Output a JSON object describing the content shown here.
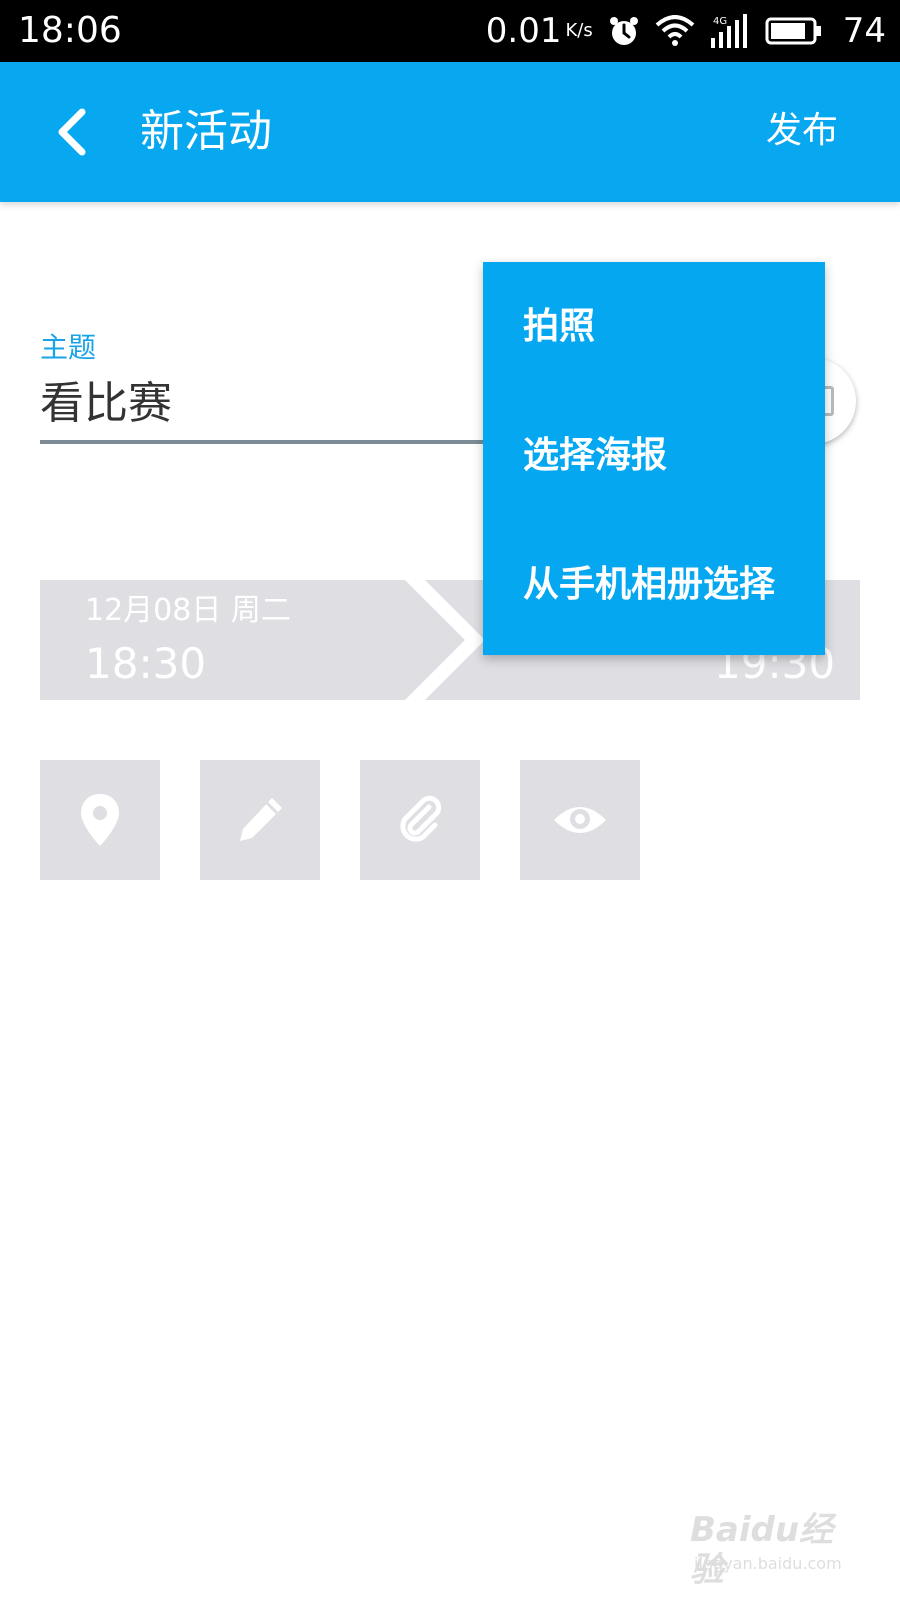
{
  "status_bar": {
    "time": "18:06",
    "speed": "0.01",
    "speed_unit": "K/s",
    "network": "4G",
    "battery": "74",
    "icons": [
      "alarm-icon",
      "wifi-icon",
      "signal-icon",
      "battery-icon"
    ]
  },
  "app_bar": {
    "title": "新活动",
    "publish_label": "发布",
    "background_color": "#07a8f0"
  },
  "topic": {
    "label": "主题",
    "value": "看比赛",
    "label_color": "#17a3e6"
  },
  "time_range": {
    "start_date": "12月08日 周二",
    "start_time": "18:30",
    "end_time": "19:30"
  },
  "action_tiles": [
    {
      "icon": "location-pin-icon"
    },
    {
      "icon": "pencil-icon"
    },
    {
      "icon": "paperclip-icon"
    },
    {
      "icon": "eye-icon"
    }
  ],
  "popup_menu": {
    "items": [
      {
        "label": "拍照"
      },
      {
        "label": "选择海报"
      },
      {
        "label": "从手机相册选择"
      }
    ],
    "background_color": "#06a7f1"
  },
  "watermark": {
    "main": "Baidu经验",
    "sub": "jingyan.baidu.com"
  }
}
